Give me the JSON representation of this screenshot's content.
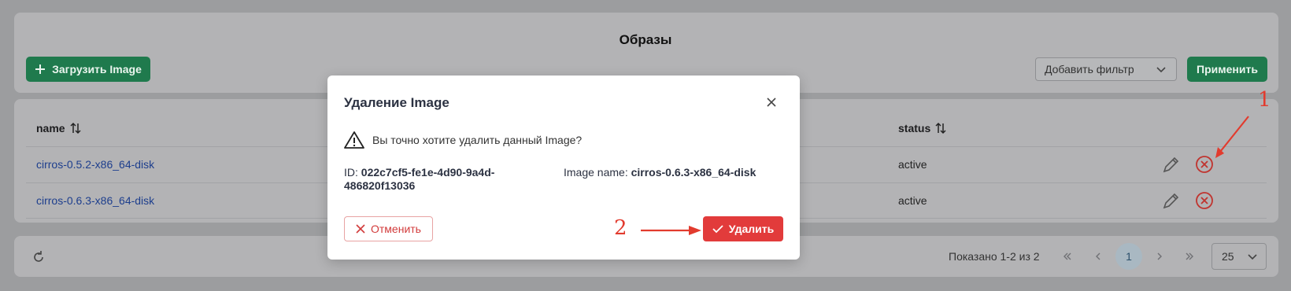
{
  "page": {
    "title": "Образы",
    "upload_button": "Загрузить Image",
    "filter_placeholder": "Добавить фильтр",
    "apply_button": "Применить"
  },
  "table": {
    "columns": [
      "name",
      "status"
    ],
    "rows": [
      {
        "name": "cirros-0.5.2-x86_64-disk",
        "status": "active"
      },
      {
        "name": "cirros-0.6.3-x86_64-disk",
        "status": "active"
      }
    ]
  },
  "pagination": {
    "info": "Показано 1-2 из 2",
    "current_page": "1",
    "page_size": "25"
  },
  "modal": {
    "title": "Удаление Image",
    "warning": "Вы точно хотите удалить данный Image?",
    "id_label": "ID:",
    "id_value": "022c7cf5-fe1e-4d90-9a4d-486820f13036",
    "name_label": "Image name:",
    "name_value": "cirros-0.6.3-x86_64-disk",
    "cancel_button": "Отменить",
    "delete_button": "Удалить"
  },
  "annotations": {
    "one": "1",
    "two": "2"
  },
  "colors": {
    "primary_green": "#1f7a4d",
    "danger_red": "#e23b3b",
    "annotation_red": "#e23b2e",
    "link_blue": "#1d3e8d"
  }
}
